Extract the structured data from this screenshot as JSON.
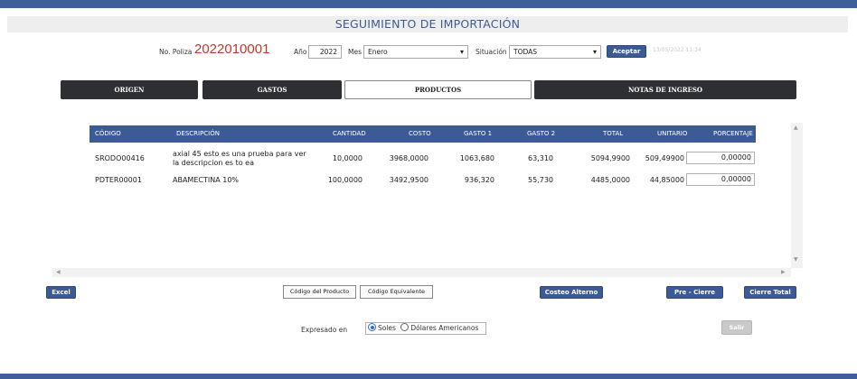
{
  "header": {
    "title": "SEGUIMIENTO DE IMPORTACIÓN"
  },
  "filters": {
    "poliza_label": "No. Poliza",
    "poliza_value": "2022010001",
    "anio_label": "Año",
    "anio_value": "2022",
    "mes_label": "Mes",
    "mes_value": "Enero",
    "situacion_label": "Situación",
    "situacion_value": "TODAS",
    "aceptar_label": "Aceptar",
    "timestamp": "13/05/2022 11:34"
  },
  "tabs": [
    {
      "label": "ORIGEN"
    },
    {
      "label": "GASTOS"
    },
    {
      "label": "PRODUCTOS"
    },
    {
      "label": "NOTAS DE INGRESO"
    }
  ],
  "table": {
    "headers": [
      "CÓDIGO",
      "DESCRIPCIÓN",
      "CANTIDAD",
      "COSTO",
      "GASTO 1",
      "GASTO 2",
      "TOTAL",
      "UNITARIO",
      "PORCENTAJE"
    ],
    "rows": [
      {
        "codigo": "SRODO00416",
        "desc1": "axial 45 esto es una prueba para ver",
        "desc2": "la descripcion es to ea",
        "cantidad": "10,0000",
        "costo": "3968,0000",
        "gasto1": "1063,680",
        "gasto2": "63,310",
        "total": "5094,9900",
        "unitario": "509,49900",
        "porcentaje": "0,00000"
      },
      {
        "codigo": "PDTER00001",
        "desc1": "ABAMECTINA 10%",
        "desc2": "",
        "cantidad": "100,0000",
        "costo": "3492,9500",
        "gasto1": "936,320",
        "gasto2": "55,730",
        "total": "4485,0000",
        "unitario": "44,85000",
        "porcentaje": "0,00000"
      }
    ]
  },
  "actions": {
    "excel": "Excel",
    "codigo_producto": "Código del Producto",
    "codigo_equivalente": "Código Equivalente",
    "costeo_alterno": "Costeo Alterno",
    "pre_cierre": "Pre - Cierre",
    "cierre_total": "Cierre Total",
    "salir": "Salir"
  },
  "currency": {
    "label": "Expresado en",
    "options": [
      "Soles",
      "Dólares Americanos"
    ],
    "selected": "Soles"
  },
  "colors": {
    "accent": "#3c5b96",
    "poliza": "#c0392b",
    "tab_dark": "#2e2f32"
  }
}
